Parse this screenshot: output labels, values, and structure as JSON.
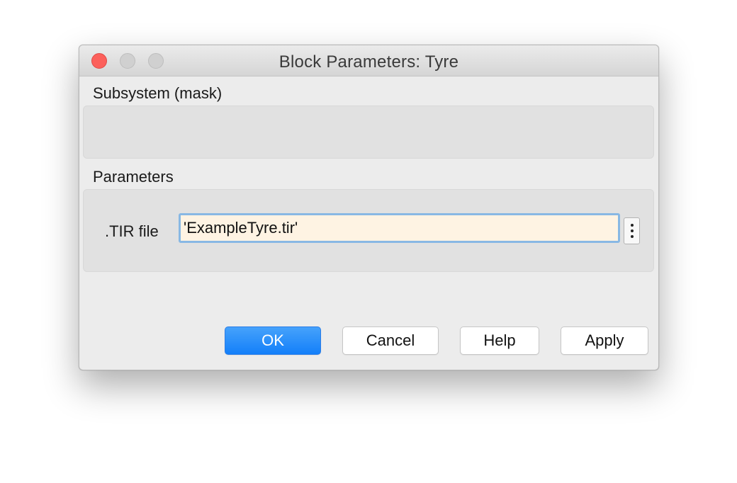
{
  "window": {
    "title": "Block Parameters: Tyre"
  },
  "subsystem": {
    "label": "Subsystem (mask)"
  },
  "parameters": {
    "label": "Parameters",
    "tir_file_label": ".TIR file",
    "tir_file_value": "'ExampleTyre.tir'"
  },
  "buttons": {
    "ok": "OK",
    "cancel": "Cancel",
    "help": "Help",
    "apply": "Apply"
  },
  "colors": {
    "close": "#fc605b",
    "primary_button": "#137ff9",
    "input_background": "#fef3e3",
    "input_focus_border": "#88b8e4"
  },
  "icons": {
    "more_button": "vertical-ellipsis-icon"
  }
}
